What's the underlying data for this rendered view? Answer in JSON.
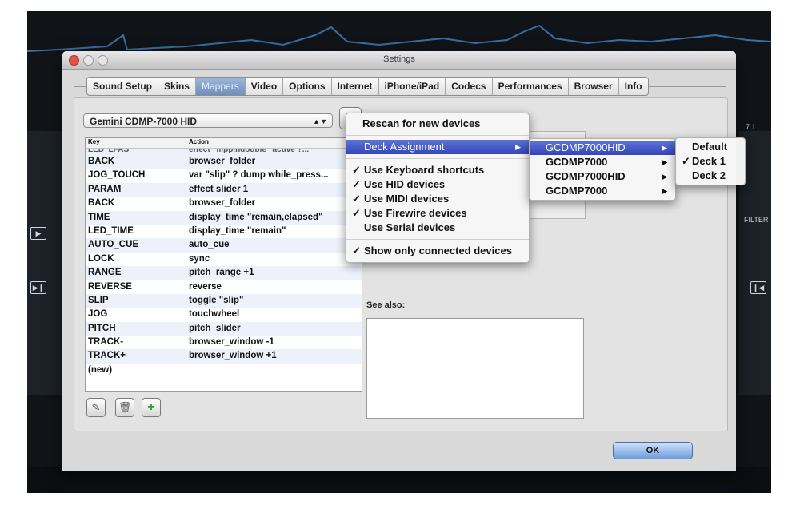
{
  "window": {
    "title": "Settings"
  },
  "tabs": [
    {
      "label": "Sound Setup"
    },
    {
      "label": "Skins"
    },
    {
      "label": "Mappers"
    },
    {
      "label": "Video"
    },
    {
      "label": "Options"
    },
    {
      "label": "Internet"
    },
    {
      "label": "iPhone/iPad"
    },
    {
      "label": "Codecs"
    },
    {
      "label": "Performances"
    },
    {
      "label": "Browser"
    },
    {
      "label": "Info"
    }
  ],
  "selected_tab": "Mappers",
  "device_select": {
    "value": "Gemini CDMP-7000 HID"
  },
  "mapper_table": {
    "columns": [
      "Key",
      "Action"
    ],
    "partial_row": {
      "key": "LED_LFAS",
      "action": "effect \"flippindouble\" active ?..."
    },
    "rows": [
      {
        "key": "BACK",
        "action": "browser_folder"
      },
      {
        "key": "JOG_TOUCH",
        "action": "var \"slip\" ? dump while_press..."
      },
      {
        "key": "PARAM",
        "action": "effect slider 1"
      },
      {
        "key": "BACK",
        "action": "browser_folder"
      },
      {
        "key": "TIME",
        "action": "display_time \"remain,elapsed\""
      },
      {
        "key": "LED_TIME",
        "action": "display_time \"remain\""
      },
      {
        "key": "AUTO_CUE",
        "action": "auto_cue"
      },
      {
        "key": "LOCK",
        "action": "sync"
      },
      {
        "key": "RANGE",
        "action": "pitch_range +1"
      },
      {
        "key": "REVERSE",
        "action": "reverse"
      },
      {
        "key": "SLIP",
        "action": "toggle \"slip\""
      },
      {
        "key": "JOG",
        "action": "touchwheel"
      },
      {
        "key": "PITCH",
        "action": "pitch_slider"
      },
      {
        "key": "TRACK-",
        "action": "browser_window -1"
      },
      {
        "key": "TRACK+",
        "action": "browser_window +1"
      },
      {
        "key": "(new)",
        "action": ""
      }
    ]
  },
  "see_also": {
    "label": "See also:"
  },
  "ok_button": {
    "label": "OK"
  },
  "menu_main": {
    "rescan": "Rescan for new devices",
    "deck_assignment": "Deck Assignment",
    "options": [
      {
        "label": "Use Keyboard shortcuts",
        "checked": true
      },
      {
        "label": "Use HID devices",
        "checked": true
      },
      {
        "label": "Use MIDI devices",
        "checked": true
      },
      {
        "label": "Use Firewire devices",
        "checked": true
      },
      {
        "label": "Use Serial devices",
        "checked": false
      }
    ],
    "show_connected": {
      "label": "Show only connected devices",
      "checked": true
    }
  },
  "menu_devices": [
    "GCDMP7000HID",
    "GCDMP7000",
    "GCDMP7000HID",
    "GCDMP7000"
  ],
  "menu_decks": [
    {
      "label": "Default",
      "checked": false
    },
    {
      "label": "Deck 1",
      "checked": true
    },
    {
      "label": "Deck 2",
      "checked": false
    }
  ],
  "icons": {
    "submenu": "triangle-right",
    "check": "checkmark",
    "remove": "trash",
    "add": "plus",
    "edit": "edit"
  },
  "colors": {
    "menu_highlight": "#4456c6",
    "ok_button": "#8ab4ea",
    "selected_tab": "#86a2cd",
    "close_button": "#e0524a"
  },
  "background": {
    "labels": [
      "7.1",
      "FILTER"
    ]
  }
}
